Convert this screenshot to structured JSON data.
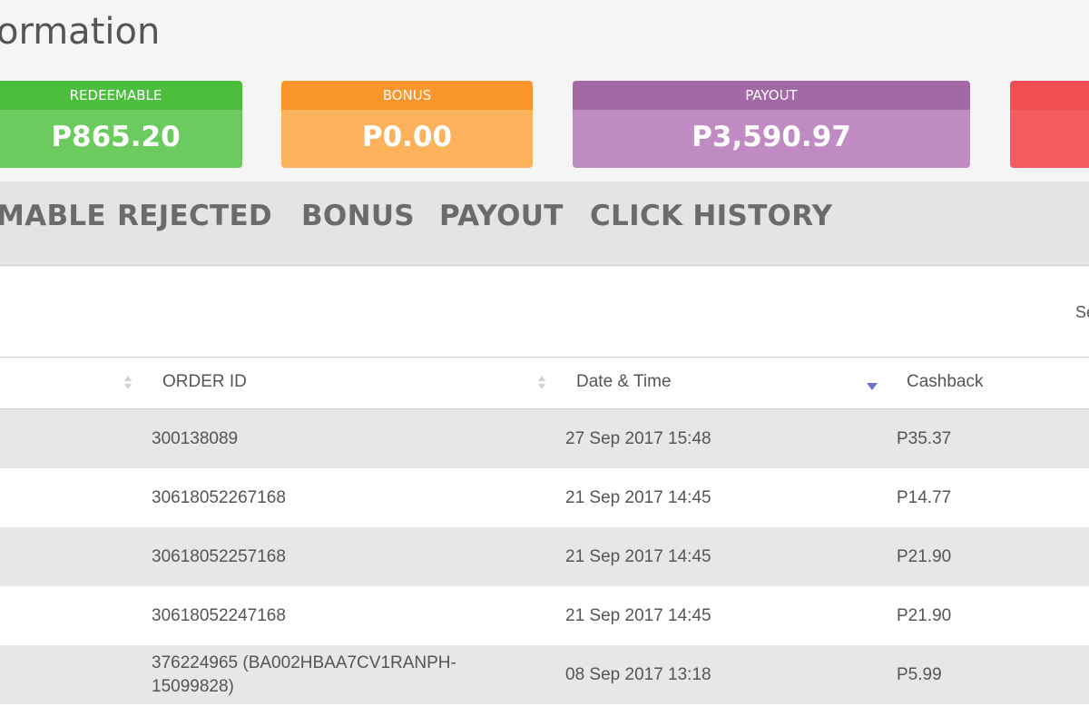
{
  "page": {
    "title": "ormation"
  },
  "cards": [
    {
      "label": "REDEEMABLE",
      "value": "P865.20"
    },
    {
      "label": "BONUS",
      "value": "P0.00"
    },
    {
      "label": "PAYOUT",
      "value": "P3,590.97"
    },
    {
      "label": "",
      "value": ""
    }
  ],
  "tabs": [
    "MABLE",
    "REJECTED",
    "BONUS",
    "PAYOUT",
    "CLICK HISTORY"
  ],
  "search": {
    "label": "Se"
  },
  "table": {
    "columns": [
      "ORDER ID",
      "Date & Time",
      "Cashback"
    ],
    "sorted_column": "Date & Time",
    "sort_direction": "descending",
    "rows": [
      {
        "order_id": "300138089",
        "datetime": "27 Sep 2017 15:48",
        "cashback": "P35.37"
      },
      {
        "order_id": "30618052267168",
        "datetime": "21 Sep 2017 14:45",
        "cashback": "P14.77"
      },
      {
        "order_id": "30618052257168",
        "datetime": "21 Sep 2017 14:45",
        "cashback": "P21.90"
      },
      {
        "order_id": "30618052247168",
        "datetime": "21 Sep 2017 14:45",
        "cashback": "P21.90"
      },
      {
        "order_id": "376224965 (BA002HBAA7CV1RANPH-15099828)",
        "datetime": "08 Sep 2017 13:18",
        "cashback": "P5.99"
      }
    ]
  },
  "colors": {
    "redeemable": "#4bbf3d",
    "bonus": "#f9952a",
    "payout": "#a368a6",
    "fourth_card": "#f04e52",
    "sort_arrow": "#6b74c8"
  }
}
